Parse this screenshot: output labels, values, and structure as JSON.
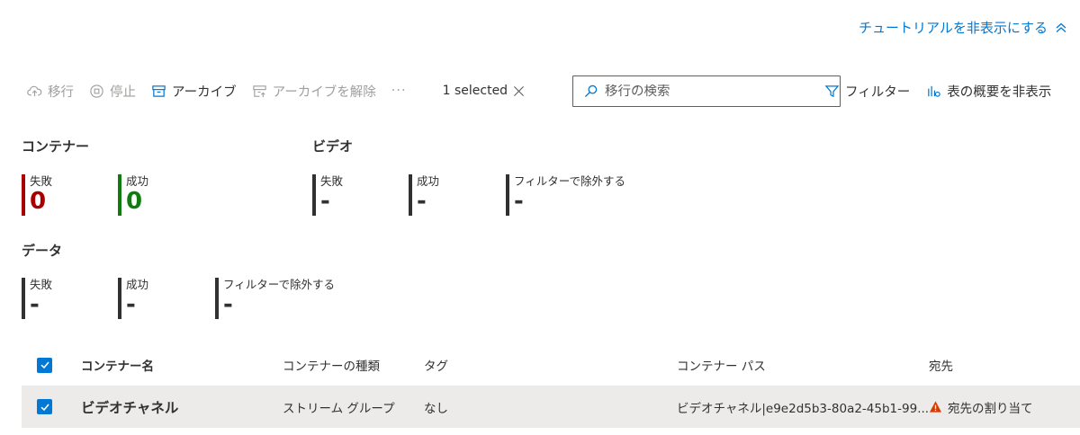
{
  "tutorial": {
    "hide_label": "チュートリアルを非表示にする"
  },
  "toolbar": {
    "migrate": "移行",
    "stop": "停止",
    "archive": "アーカイブ",
    "unarchive": "アーカイブを解除",
    "more": "···",
    "selected": "1 selected",
    "search_placeholder": "移行の検索",
    "filter": "フィルター",
    "hide_summary": "表の概要を非表示"
  },
  "summary": {
    "containers": {
      "title": "コンテナー",
      "failed": {
        "label": "失敗",
        "value": "0"
      },
      "success": {
        "label": "成功",
        "value": "0"
      }
    },
    "videos": {
      "title": "ビデオ",
      "failed": {
        "label": "失敗",
        "value": "-"
      },
      "success": {
        "label": "成功",
        "value": "-"
      },
      "filtered": {
        "label": "フィルターで除外する",
        "value": "-"
      }
    },
    "data": {
      "title": "データ",
      "failed": {
        "label": "失敗",
        "value": "-"
      },
      "success": {
        "label": "成功",
        "value": "-"
      },
      "filtered": {
        "label": "フィルターで除外する",
        "value": "-"
      }
    }
  },
  "table": {
    "columns": {
      "name": "コンテナー名",
      "type": "コンテナーの種類",
      "tag": "タグ",
      "path": "コンテナー パス",
      "dest": "宛先"
    },
    "rows": [
      {
        "name": "ビデオチャネル",
        "type": "ストリーム グループ",
        "tag": "なし",
        "path": "ビデオチャネル|e9e2d5b3-80a2-45b1-99...",
        "dest": "宛先の割り当て"
      }
    ]
  },
  "colors": {
    "accent": "#0078d4",
    "failed": "#a80000",
    "success": "#107c10",
    "warning": "#d83b01"
  }
}
